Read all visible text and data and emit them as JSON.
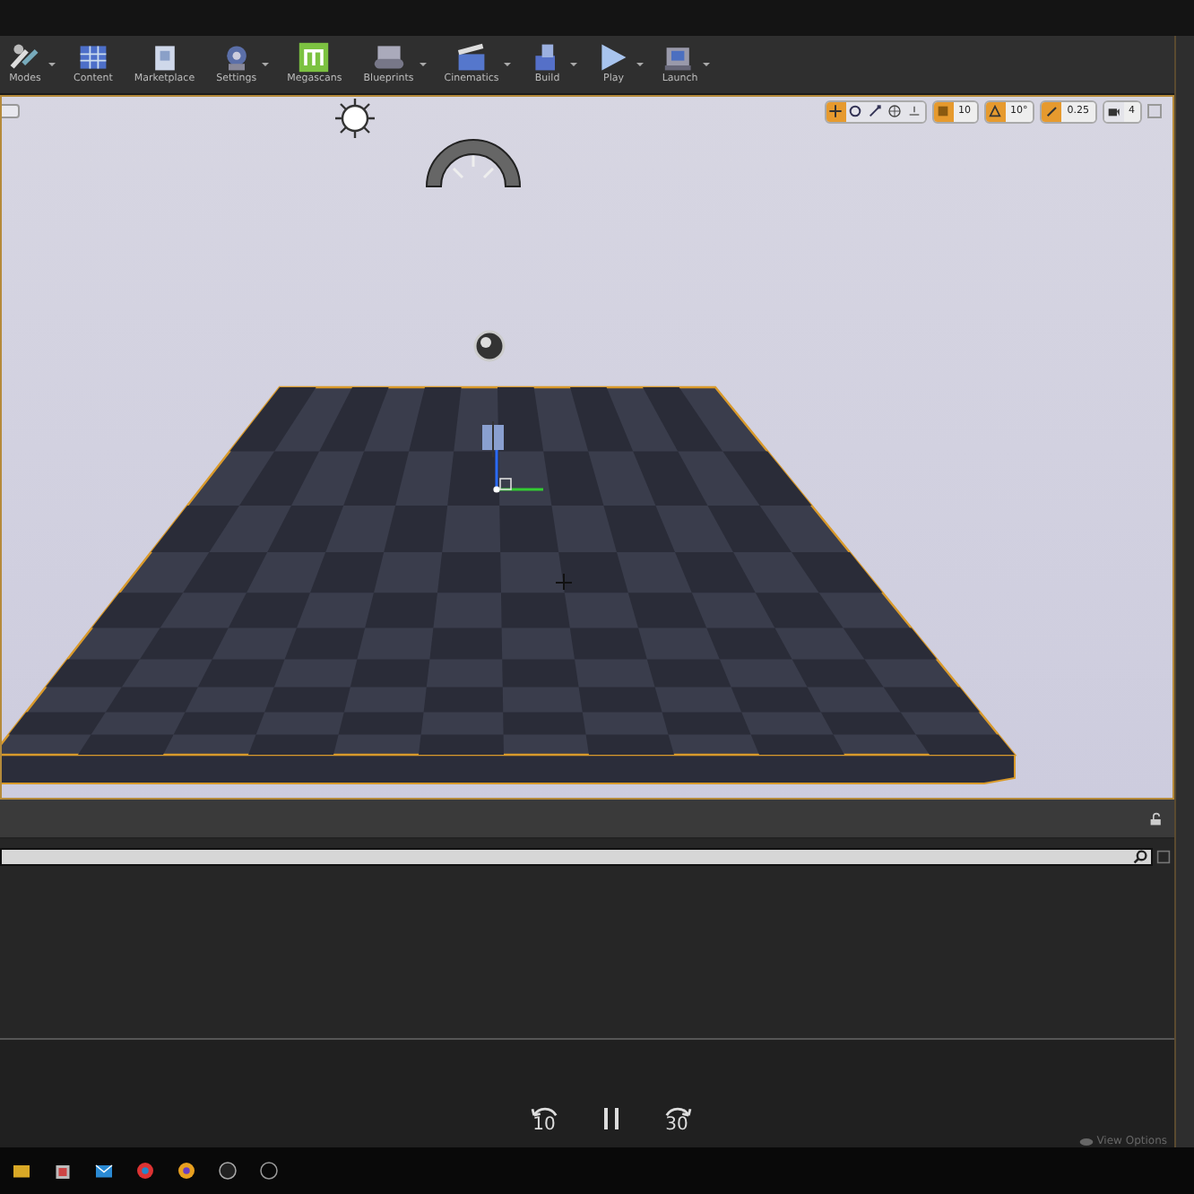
{
  "toolbar": {
    "buttons": [
      {
        "label": "Modes",
        "caret": true
      },
      {
        "label": "Content",
        "caret": false
      },
      {
        "label": "Marketplace",
        "caret": false
      },
      {
        "label": "Settings",
        "caret": true
      },
      {
        "label": "Megascans",
        "caret": false
      },
      {
        "label": "Blueprints",
        "caret": true
      },
      {
        "label": "Cinematics",
        "caret": true
      },
      {
        "label": "Build",
        "caret": true
      },
      {
        "label": "Play",
        "caret": true
      },
      {
        "label": "Launch",
        "caret": true
      }
    ]
  },
  "viewport": {
    "tools": [
      {
        "kind": "translate",
        "on": true
      },
      {
        "kind": "rotate",
        "on": false
      },
      {
        "kind": "scale",
        "on": false
      },
      {
        "kind": "world",
        "on": false
      },
      {
        "kind": "surface",
        "on": false
      }
    ],
    "snaps": [
      {
        "kind": "grid",
        "on": true,
        "value": "10"
      },
      {
        "kind": "angle",
        "on": true,
        "value": "10°"
      },
      {
        "kind": "scale",
        "on": true,
        "value": "0.25"
      },
      {
        "kind": "camera",
        "on": false,
        "value": "4"
      }
    ]
  },
  "player": {
    "back": "10",
    "forward": "30",
    "paused": false,
    "view_options": "View Options"
  }
}
